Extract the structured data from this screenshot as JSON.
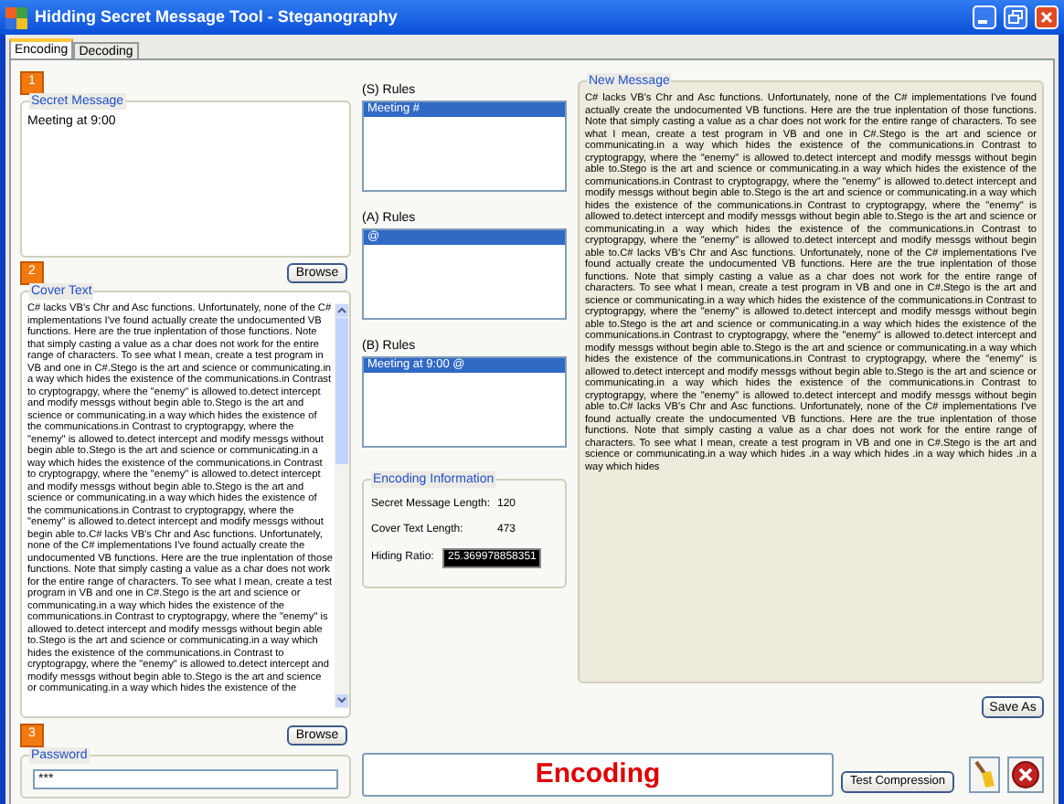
{
  "window": {
    "title": "Hidding Secret Message Tool - Steganography"
  },
  "tabs": [
    {
      "label": "Encoding",
      "selected": true
    },
    {
      "label": "Decoding",
      "selected": false
    }
  ],
  "secret_message": {
    "step": "1",
    "label": "Secret Message",
    "value": "Meeting at 9:00",
    "button": "Browse"
  },
  "cover_text": {
    "step": "2",
    "label": "Cover Text",
    "value": "C# lacks VB's Chr and Asc functions. Unfortunately, none of the C# implementations I've found actually create the undocumented VB functions. Here are the true inplentation of those functions. Note that simply casting a value as a char does not work for the entire range of characters. To see what I mean, create a test program in VB and one in C#.Stego is the art and science or communicating.in a way which hides the existence of the communications.in Contrast to cryptograpgy, where the \"enemy\" is allowed to.detect intercept and modify messgs without begin able to.Stego is the art and science or communicating.in a way which hides the existence of the communications.in Contrast to cryptograpgy, where the \"enemy\" is allowed to.detect intercept and modify messgs without begin able to.Stego is the art and science or communicating.in a way which hides the existence of the communications.in Contrast to cryptograpgy, where the \"enemy\" is allowed to.detect intercept and modify messgs without begin able to.Stego is the art and science or communicating.in a way which hides the existence of the communications.in Contrast to cryptograpgy, where the \"enemy\" is allowed to.detect intercept and modify messgs without begin able to.C# lacks VB's Chr and Asc functions. Unfortunately, none of the C# implementations I've found actually create the undocumented VB functions. Here are the true inplentation of those functions. Note that simply casting a value as a char does not work for the entire range of characters. To see what I mean, create a test program in VB and one in C#.Stego is the art and science or communicating.in a way which hides the existence of the communications.in Contrast to cryptograpgy, where the \"enemy\" is allowed to.detect intercept and modify messgs without begin able to.Stego is the art and science or communicating.in a way which hides the existence of the communications.in Contrast to cryptograpgy, where the \"enemy\" is allowed to.detect intercept and modify messgs without begin able to.Stego is the art and science or communicating.in a way which hides the existence of the",
    "button": "Browse"
  },
  "password": {
    "step": "3",
    "label": "Password",
    "value": "***"
  },
  "rules": [
    {
      "label": "(S) Rules",
      "items": [
        {
          "text": "Meeting #",
          "selected": true
        }
      ]
    },
    {
      "label": "(A) Rules",
      "items": [
        {
          "text": "@",
          "selected": true
        }
      ]
    },
    {
      "label": "(B) Rules",
      "items": [
        {
          "text": "Meeting at 9:00 @",
          "selected": true
        }
      ]
    }
  ],
  "encoding_information": {
    "label": "Encoding Information",
    "rows": [
      {
        "label": "Secret Message Length:",
        "value": "120",
        "kind": "plain"
      },
      {
        "label": "Cover Text Length:",
        "value": "473",
        "kind": "plain"
      },
      {
        "label": "Hiding Ratio:",
        "value": "25.369978858351",
        "kind": "highlighted"
      }
    ]
  },
  "new_message": {
    "label": "New Message",
    "value": "C# lacks VB's Chr and Asc functions. Unfortunately, none of the C# implementations I've found actually create the undocumented VB functions. Here are the true inplentation of those functions. Note that simply casting a value as a char does not work for the entire range of characters. To see what I mean, create a test program in VB and one in C#.Stego is the art and science or communicating.in a way which hides the existence of the communications.in Contrast to cryptograpgy, where the \"enemy\" is allowed to.detect intercept and modify messgs without begin able to.Stego is the art and science or communicating.in a way which hides the existence of the communications.in Contrast to cryptograpgy, where the \"enemy\" is allowed to.detect intercept and modify messgs without begin able to.Stego is the art and science or communicating.in a way which hides the existence of the communications.in Contrast to cryptograpgy, where the \"enemy\" is allowed to.detect intercept and modify messgs without begin able to.Stego is the art and science or communicating.in a way which hides the existence of the communications.in Contrast to cryptograpgy, where the \"enemy\" is allowed to.detect intercept and modify messgs without begin able to.C# lacks VB's Chr and Asc functions. Unfortunately, none of the C# implementations I've found actually create the undocumented VB functions. Here are the true inplentation of those functions. Note that simply casting a value as a char does not work for the entire range of characters. To see what I mean, create a test program in VB and one in C#.Stego is the art and science or communicating.in a way which hides the existence of the communications.in Contrast to cryptograpgy, where the \"enemy\" is allowed to.detect intercept and modify messgs without begin able to.Stego is the art and science or communicating.in a way which hides the existence of the communications.in Contrast to cryptograpgy, where the \"enemy\" is allowed to.detect intercept and modify messgs without begin able to.Stego is the art and science or communicating.in a way which hides the existence of the communications.in Contrast to cryptograpgy, where the \"enemy\" is allowed to.detect intercept and modify messgs without begin able to.Stego is the art and science or communicating.in a way which hides the existence of the communications.in Contrast to cryptograpgy, where the \"enemy\" is allowed to.detect intercept and modify messgs without begin able to.C# lacks VB's Chr and Asc functions. Unfortunately, none of the C# implementations I've found actually create the undocumented VB functions. Here are the true inplentation of those functions. Note that simply casting a value as a char does not work for the entire range of characters. To see what I mean, create a test program in VB and one in C#.Stego is the art and science or communicating.in a way which hides .in a way which hides .in a way which hides .in a way which hides",
    "button": "Save As"
  },
  "status": "Encoding",
  "buttons": [
    {
      "label": "Test Compression"
    }
  ]
}
